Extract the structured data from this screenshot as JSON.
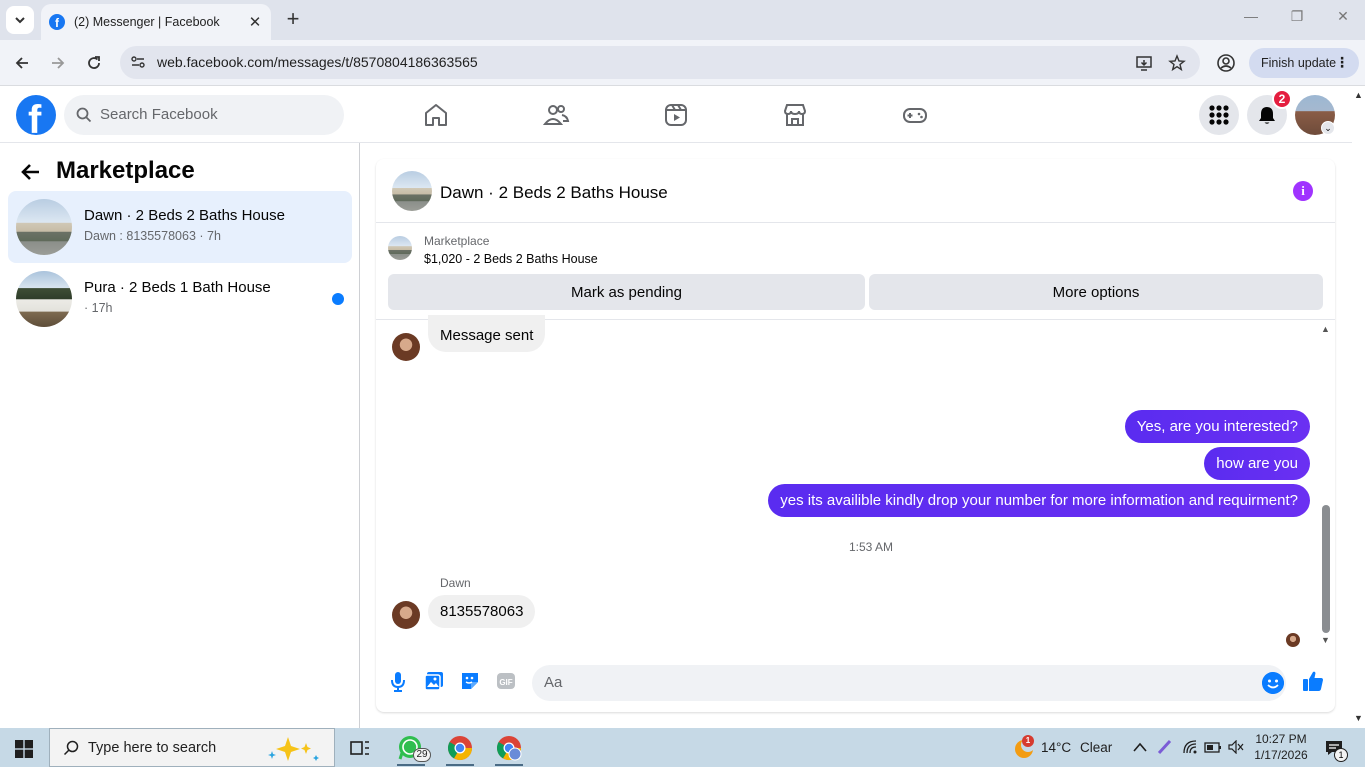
{
  "browser": {
    "tab_title": "(2) Messenger | Facebook",
    "url": "web.facebook.com/messages/t/8570804186363565",
    "finish_update_label": "Finish update"
  },
  "fb_header": {
    "search_placeholder": "Search Facebook",
    "notification_count": "2",
    "brand_color": "#1877f2"
  },
  "sidebar": {
    "title": "Marketplace",
    "conversations": [
      {
        "name": "Dawn · 2 Beds 2 Baths House",
        "sub": "Dawn : 8135578063 · 7h",
        "active": true,
        "unread": false
      },
      {
        "name": "Pura · 2 Beds 1 Bath House",
        "sub": " · 17h",
        "active": false,
        "unread": true
      }
    ]
  },
  "chat": {
    "title": "Dawn · 2 Beds 2 Baths House",
    "listing_label": "Marketplace",
    "listing_price": "$1,020 - 2 Beds 2 Baths House",
    "mark_pending_label": "Mark as pending",
    "more_options_label": "More options",
    "messages": [
      {
        "from": "them",
        "text": "Message sent"
      },
      {
        "from": "me",
        "text": "Yes, are you interested?"
      },
      {
        "from": "me",
        "text": "how are you"
      },
      {
        "from": "me",
        "text": "yes its availible kindly drop your number for more information and requirment?"
      },
      {
        "from": "them",
        "sender": "Dawn",
        "text": "8135578063"
      }
    ],
    "timestamp": "1:53 AM",
    "composer_placeholder": "Aa",
    "outgoing_color": "#6b30f2",
    "accent_color": "#0a7cff"
  },
  "taskbar": {
    "search_placeholder": "Type here to search",
    "whatsapp_badge": "29",
    "weather_alert": "1",
    "temperature": "14°C",
    "weather_condition": "Clear",
    "time": "10:27 PM",
    "date": "1/17/2026",
    "notification_count": "1"
  }
}
